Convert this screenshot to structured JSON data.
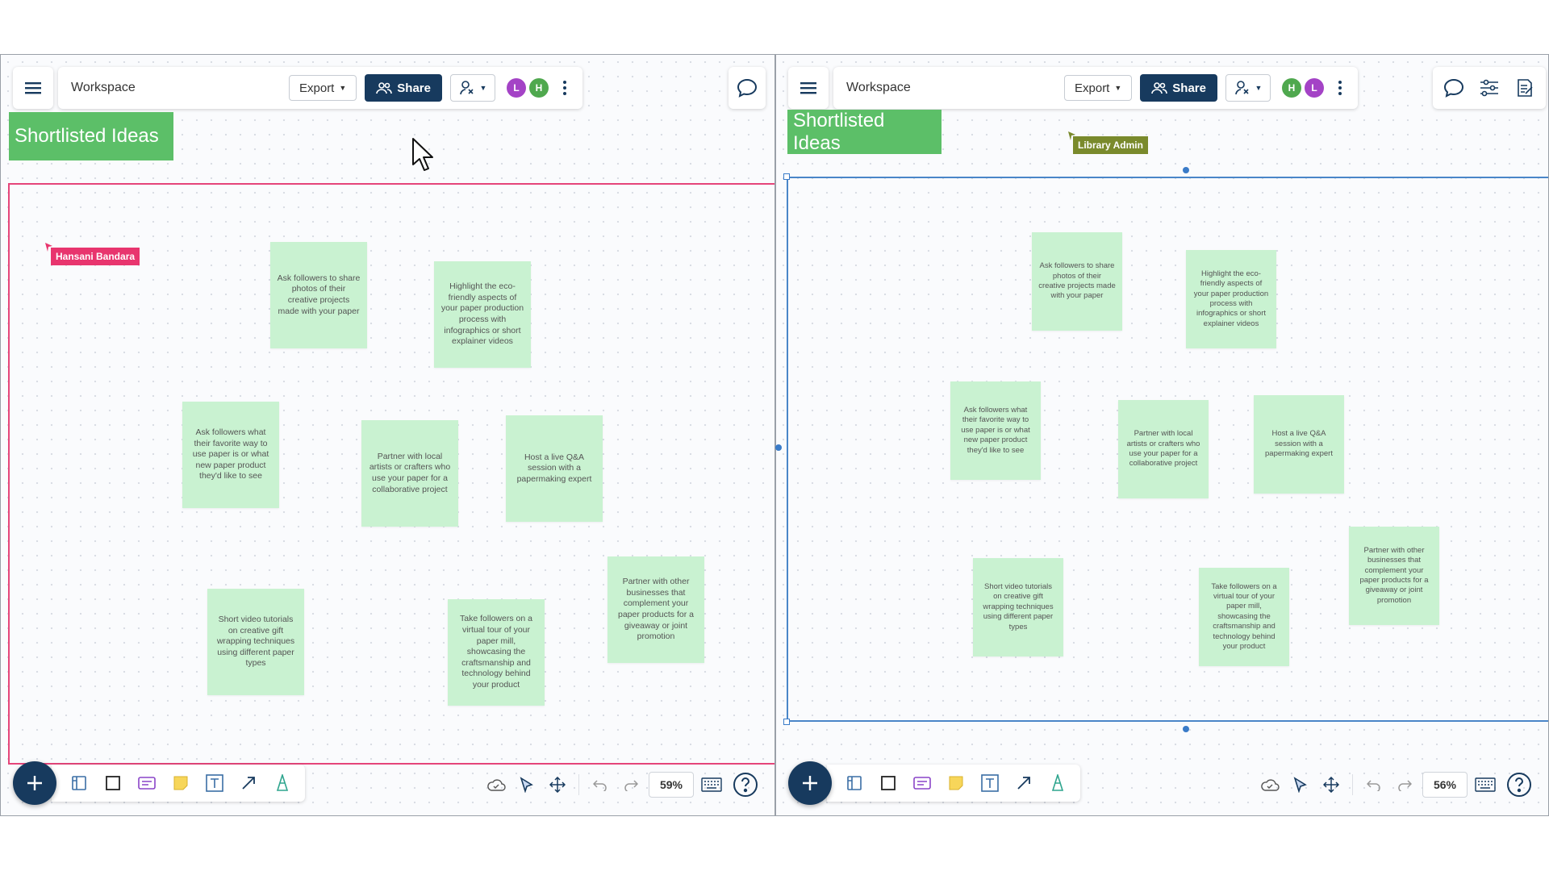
{
  "left": {
    "workspace_name": "Workspace",
    "export_label": "Export",
    "share_label": "Share",
    "avatars": [
      {
        "initial": "L",
        "color": "#a443c6"
      },
      {
        "initial": "H",
        "color": "#4fa84e"
      }
    ],
    "banner_title": "Shortlisted Ideas",
    "cursor_user": "Hansani Bandara",
    "cursor_color": "#e8356e",
    "zoom": "59%"
  },
  "right": {
    "workspace_name": "Workspace",
    "export_label": "Export",
    "share_label": "Share",
    "avatars": [
      {
        "initial": "H",
        "color": "#4fa84e"
      },
      {
        "initial": "L",
        "color": "#a443c6"
      }
    ],
    "banner_title": "Shortlisted Ideas",
    "cursor_user": "Library Admin",
    "cursor_color": "#7a8a2c",
    "zoom": "56%"
  },
  "stickies": [
    "Ask followers to share photos of their creative projects made with your paper",
    "Highlight the eco-friendly aspects of your paper production process with infographics or short explainer videos",
    "Ask followers what their favorite way to use paper is or what new paper product they'd like to see",
    "Partner with local artists or crafters who use your paper for a collaborative project",
    "Host a live Q&A session with a papermaking expert",
    "Short video tutorials on creative gift wrapping techniques using different paper types",
    "Take followers on a virtual tour of your paper mill, showcasing the craftsmanship and technology behind your product",
    "Partner with other businesses that complement your paper products for a giveaway or joint promotion"
  ],
  "icons": {
    "menu": "hamburger-menu-icon",
    "comment": "comment-icon",
    "settings": "sliders-icon",
    "notes": "notes-icon",
    "cloud": "cloud-sync-icon",
    "select": "pointer-icon",
    "pan": "move-icon",
    "undo": "undo-icon",
    "redo": "redo-icon",
    "keyboard": "keyboard-icon",
    "help": "help-icon"
  }
}
